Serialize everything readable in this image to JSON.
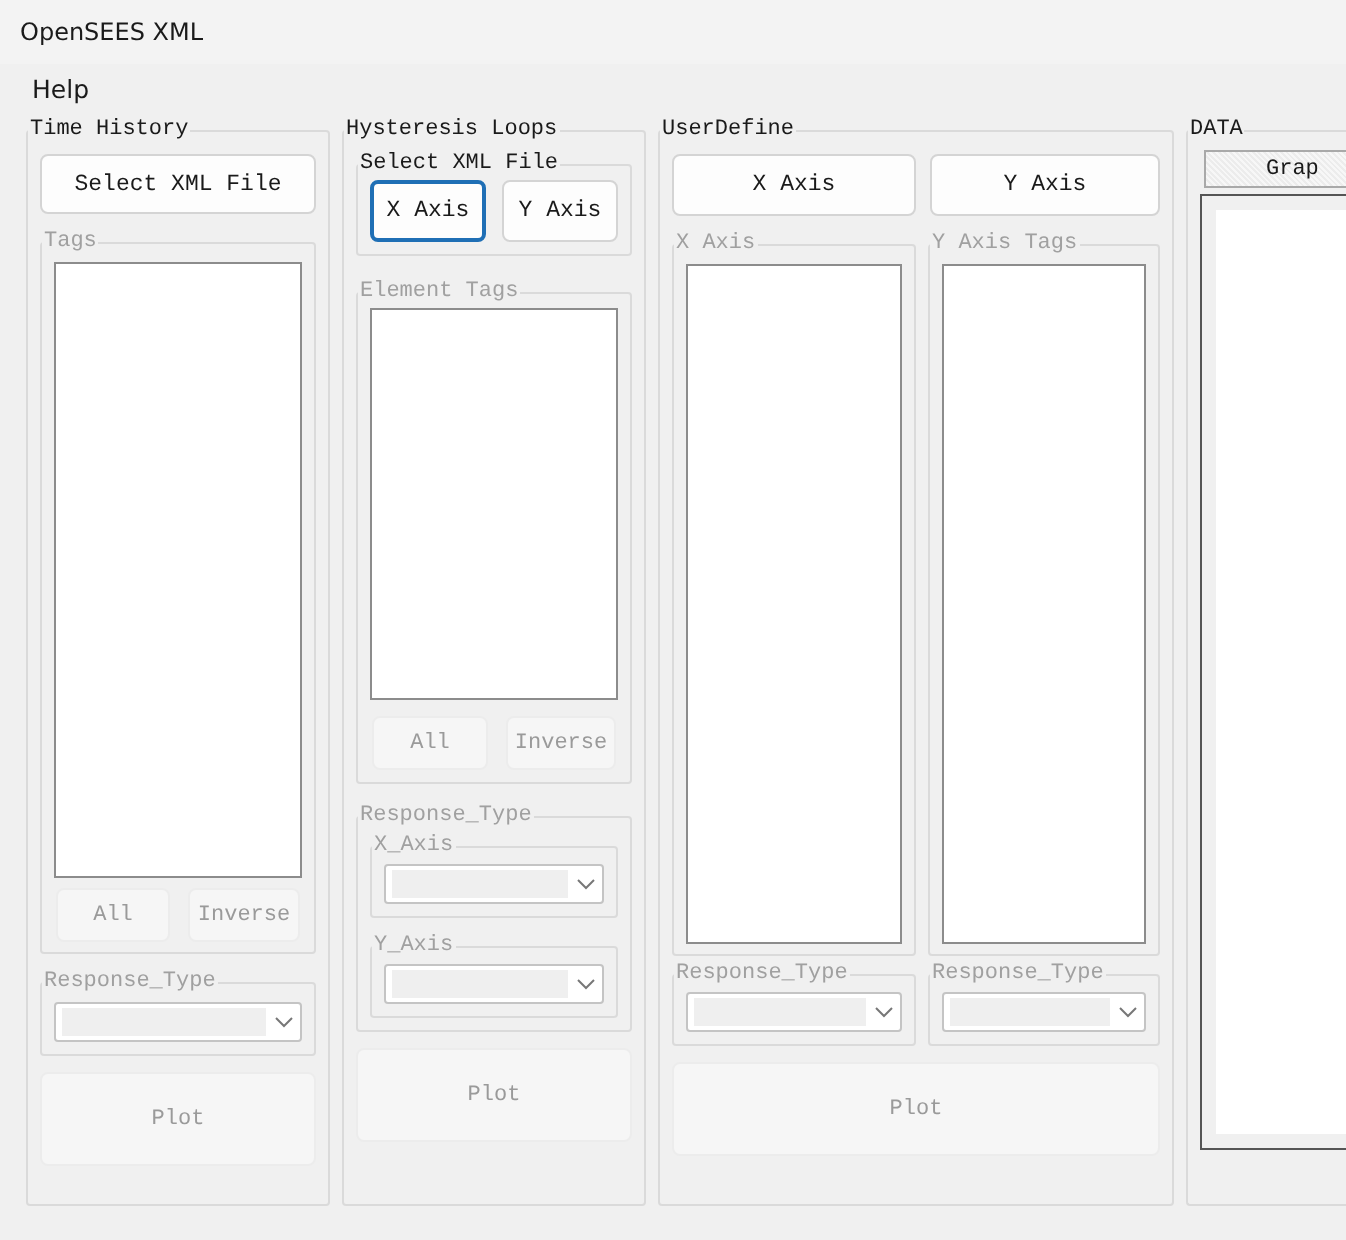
{
  "window": {
    "title": "OpenSEES XML"
  },
  "menu": [
    {
      "label": "Help"
    }
  ],
  "time_history": {
    "title": "Time History",
    "select_button": {
      "label": "Select XML File",
      "disabled": false
    },
    "tags": {
      "title": "Tags",
      "disabled": true
    },
    "all_button": {
      "label": "All",
      "disabled": true
    },
    "inverse_button": {
      "label": "Inverse",
      "disabled": true
    },
    "response_type": {
      "title": "Response_Type",
      "disabled": true
    },
    "plot_button": {
      "label": "Plot",
      "disabled": true
    }
  },
  "hysteresis_loops": {
    "title": "Hysteresis Loops",
    "select_group": {
      "title": "Select XML File",
      "disabled": false
    },
    "x_axis_button": {
      "label": "X Axis",
      "disabled": false,
      "focused": true
    },
    "y_axis_button": {
      "label": "Y Axis",
      "disabled": false,
      "focused": false
    },
    "element_tags": {
      "title": "Element Tags",
      "disabled": true
    },
    "all_button": {
      "label": "All",
      "disabled": true
    },
    "inverse_button": {
      "label": "Inverse",
      "disabled": true
    },
    "response_type": {
      "title": "Response_Type",
      "disabled": true
    },
    "x_axis": {
      "title": "X_Axis",
      "disabled": true
    },
    "y_axis": {
      "title": "Y_Axis",
      "disabled": true
    },
    "plot_button": {
      "label": "Plot",
      "disabled": true
    }
  },
  "user_define": {
    "title": "UserDefine",
    "x_axis_button": {
      "label": "X Axis",
      "disabled": false
    },
    "y_axis_button": {
      "label": "Y Axis",
      "disabled": false
    },
    "x_axis": {
      "title": "X Axis",
      "disabled": true
    },
    "y_axis_tags": {
      "title": "Y Axis Tags",
      "disabled": true
    },
    "x_response_type": {
      "title": "Response_Type",
      "disabled": true
    },
    "y_response_type": {
      "title": "Response_Type",
      "disabled": true
    },
    "plot_button": {
      "label": "Plot",
      "disabled": true
    }
  },
  "data": {
    "title": "DATA",
    "graph_tab": {
      "label": "Grap"
    }
  }
}
